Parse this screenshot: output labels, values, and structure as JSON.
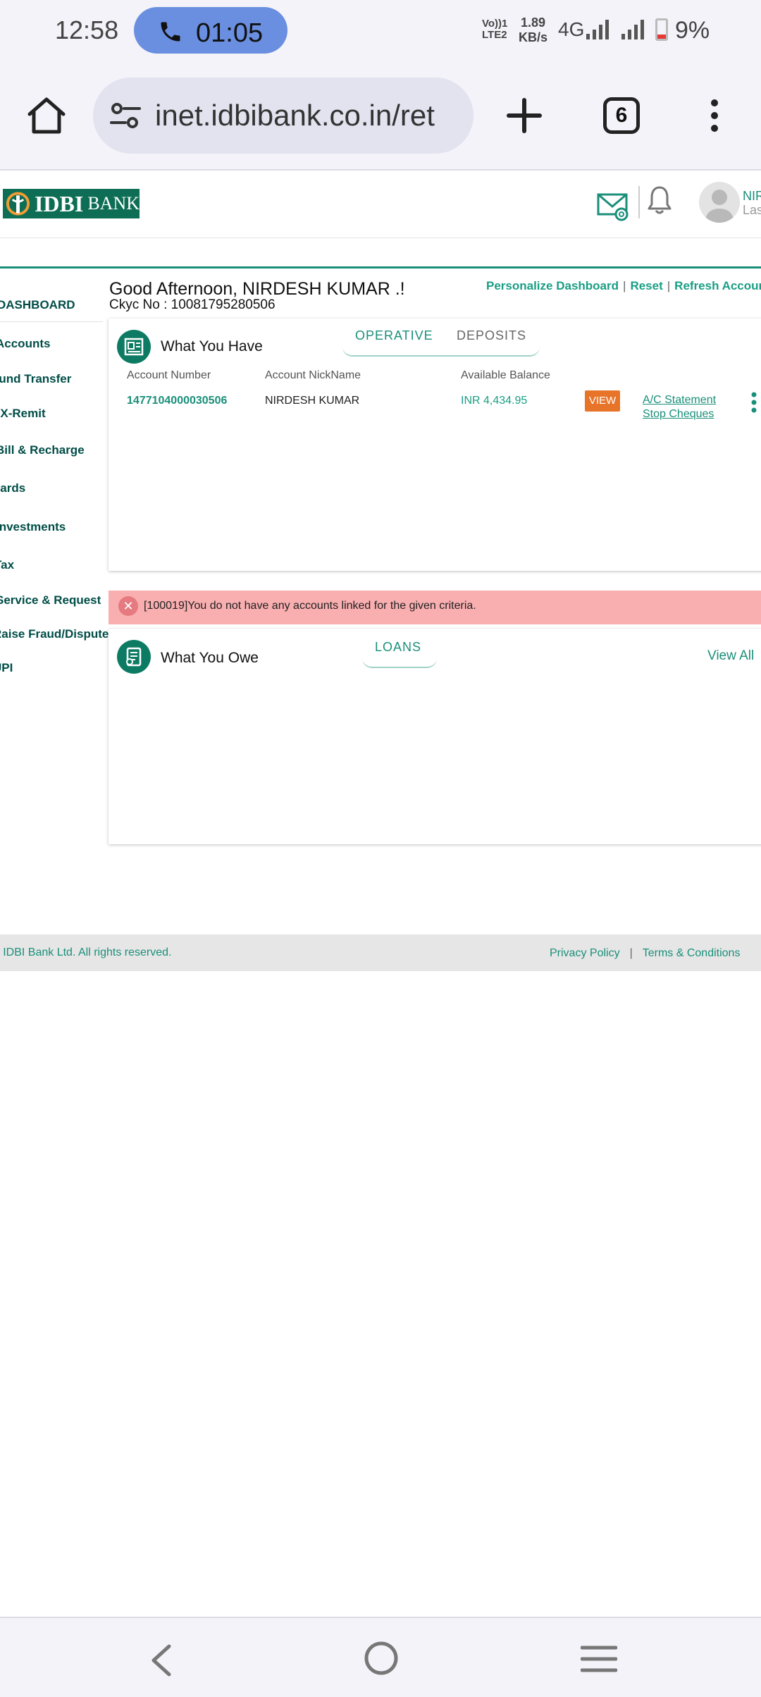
{
  "status_bar": {
    "time": "12:58",
    "call_timer": "01:05",
    "volte_line1": "Vo))1",
    "volte_line2": "LTE2",
    "speed_value": "1.89",
    "speed_unit": "KB/s",
    "network": "4G",
    "battery": "9%"
  },
  "browser": {
    "url": "inet.idbibank.co.in/ret",
    "tab_count": "6"
  },
  "header": {
    "logo_text": "IDBI",
    "logo_suffix": "BANK",
    "user_name": "NIR",
    "user_sub": "Las"
  },
  "sidebar": {
    "items": [
      {
        "label": "DASHBOARD"
      },
      {
        "label": "Accounts"
      },
      {
        "label": "Fund Transfer"
      },
      {
        "label": "FX-Remit"
      },
      {
        "label": "Bill & Recharge"
      },
      {
        "label": "Cards"
      },
      {
        "label": "Investments"
      },
      {
        "label": "Tax"
      },
      {
        "label": "Service & Request"
      },
      {
        "label": "Raise Fraud/Dispute"
      },
      {
        "label": "UPI"
      }
    ]
  },
  "dashboard": {
    "greeting": "Good Afternoon, NIRDESH  KUMAR  .!",
    "ckyc": "Ckyc No : 10081795280506",
    "links": {
      "personalize": "Personalize Dashboard",
      "reset": "Reset",
      "refresh": "Refresh Accounts"
    }
  },
  "what_you_have": {
    "title": "What You Have",
    "tabs": [
      "OPERATIVE",
      "DEPOSITS"
    ],
    "columns": [
      "Account Number",
      "Account NickName",
      "Available Balance"
    ],
    "row": {
      "account_number": "1477104000030506",
      "nickname": "NIRDESH KUMAR",
      "balance": "INR  4,434.95",
      "view_label": "VIEW",
      "statement_link": "A/C Statement",
      "stop_cheques_link": "Stop Cheques"
    }
  },
  "error": {
    "message": "[100019]You do not have any accounts linked for the given criteria."
  },
  "what_you_owe": {
    "title": "What You Owe",
    "tab": "LOANS",
    "view_all": "View All"
  },
  "footer": {
    "copyright": "© IDBI Bank Ltd. All rights reserved.",
    "privacy": "Privacy Policy",
    "separator": "|",
    "terms": "Terms & Conditions"
  },
  "colors": {
    "brand_green": "#0d6e55",
    "link_green": "#1a8f7a",
    "view_button": "#e8742a",
    "error_bg": "#f9aeb0"
  }
}
